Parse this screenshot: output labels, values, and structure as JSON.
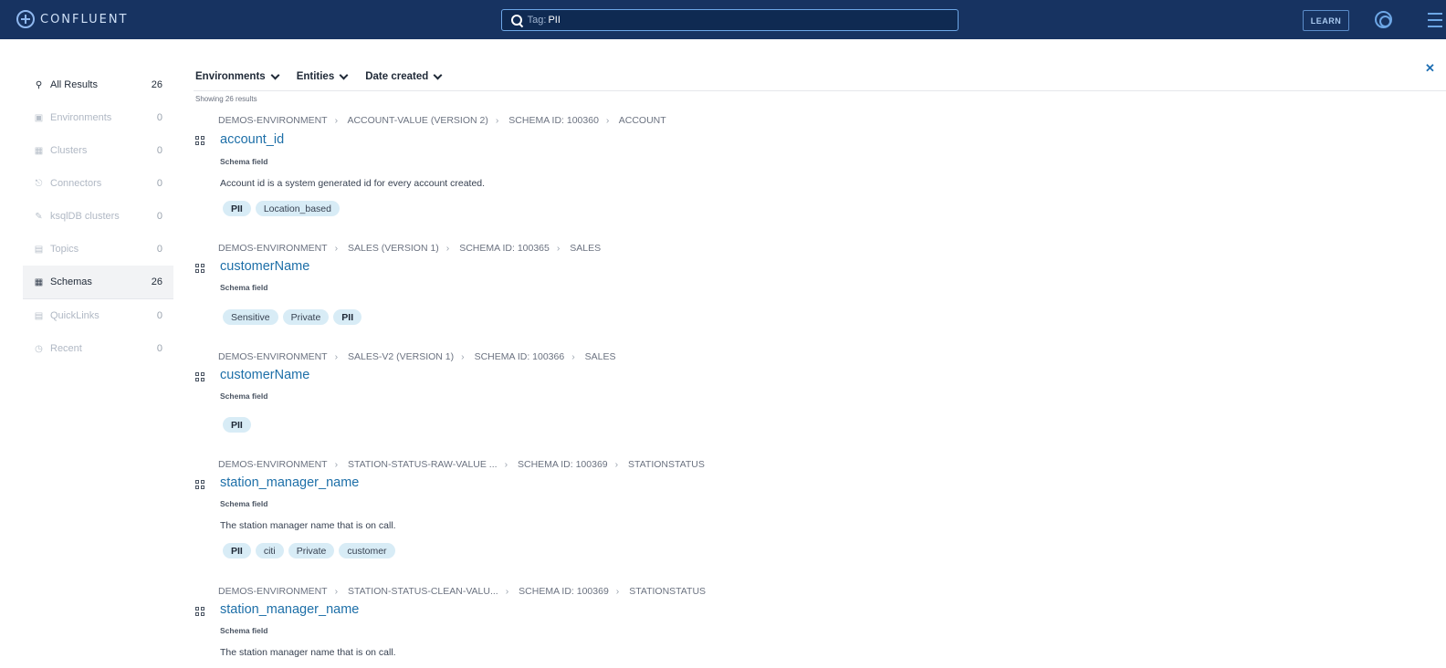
{
  "header": {
    "brand": "CONFLUENT",
    "search_prefix": "Tag:",
    "search_value": "PII",
    "learn_label": "LEARN"
  },
  "sidebar": {
    "items": [
      {
        "label": "All Results",
        "count": "26",
        "icon": "search-icon"
      },
      {
        "label": "Environments",
        "count": "0",
        "icon": "database-icon"
      },
      {
        "label": "Clusters",
        "count": "0",
        "icon": "grid-icon"
      },
      {
        "label": "Connectors",
        "count": "0",
        "icon": "plug-icon"
      },
      {
        "label": "ksqlDB clusters",
        "count": "0",
        "icon": "pencil-icon"
      },
      {
        "label": "Topics",
        "count": "0",
        "icon": "topics-icon"
      },
      {
        "label": "Schemas",
        "count": "26",
        "icon": "schema-icon"
      },
      {
        "label": "QuickLinks",
        "count": "0",
        "icon": "archive-icon"
      },
      {
        "label": "Recent",
        "count": "0",
        "icon": "clock-icon"
      }
    ]
  },
  "filters": {
    "environments": "Environments",
    "entities": "Entities",
    "date_created": "Date created",
    "showing": "Showing 26 results"
  },
  "results": [
    {
      "crumbs": [
        "DEMOS-ENVIRONMENT",
        "ACCOUNT-VALUE (VERSION 2)",
        "SCHEMA ID: 100360",
        "ACCOUNT"
      ],
      "title": "account_id",
      "subtitle": "Schema field",
      "description": "Account id is a system generated id for every account created.",
      "tags": [
        "PII",
        "Location_based"
      ]
    },
    {
      "crumbs": [
        "DEMOS-ENVIRONMENT",
        "SALES (VERSION 1)",
        "SCHEMA ID: 100365",
        "SALES"
      ],
      "title": "customerName",
      "subtitle": "Schema field",
      "description": "",
      "tags": [
        "Sensitive",
        "Private",
        "PII"
      ]
    },
    {
      "crumbs": [
        "DEMOS-ENVIRONMENT",
        "SALES-V2 (VERSION 1)",
        "SCHEMA ID: 100366",
        "SALES"
      ],
      "title": "customerName",
      "subtitle": "Schema field",
      "description": "",
      "tags": [
        "PII"
      ]
    },
    {
      "crumbs": [
        "DEMOS-ENVIRONMENT",
        "STATION-STATUS-RAW-VALUE ...",
        "SCHEMA ID: 100369",
        "STATIONSTATUS"
      ],
      "title": "station_manager_name",
      "subtitle": "Schema field",
      "description": "The station manager name that is on call.",
      "tags": [
        "PII",
        "citi",
        "Private",
        "customer"
      ]
    },
    {
      "crumbs": [
        "DEMOS-ENVIRONMENT",
        "STATION-STATUS-CLEAN-VALU...",
        "SCHEMA ID: 100369",
        "STATIONSTATUS"
      ],
      "title": "station_manager_name",
      "subtitle": "Schema field",
      "description": "The station manager name that is on call.",
      "tags": []
    }
  ]
}
